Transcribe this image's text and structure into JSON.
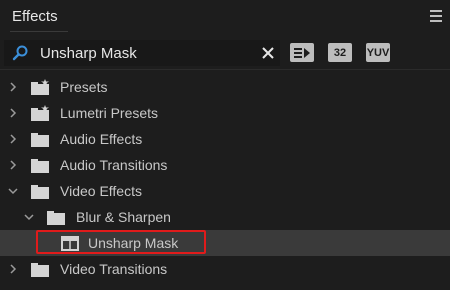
{
  "panel": {
    "title": "Effects"
  },
  "search": {
    "value": "Unsharp Mask"
  },
  "filters": {
    "accel_icon": "accelerated-effects-icon",
    "bit32_label": "32",
    "yuv_label": "YUV"
  },
  "tree": {
    "items": [
      {
        "label": "Presets",
        "icon": "folder-star-icon",
        "state": "collapsed",
        "level": 0
      },
      {
        "label": "Lumetri Presets",
        "icon": "folder-star-icon",
        "state": "collapsed",
        "level": 0
      },
      {
        "label": "Audio Effects",
        "icon": "folder-icon",
        "state": "collapsed",
        "level": 0
      },
      {
        "label": "Audio Transitions",
        "icon": "folder-icon",
        "state": "collapsed",
        "level": 0
      },
      {
        "label": "Video Effects",
        "icon": "folder-icon",
        "state": "expanded",
        "level": 0
      },
      {
        "label": "Blur & Sharpen",
        "icon": "folder-icon",
        "state": "expanded",
        "level": 1
      },
      {
        "label": "Unsharp Mask",
        "icon": "effect-icon",
        "state": "leaf",
        "level": 2,
        "selected": true
      },
      {
        "label": "Video Transitions",
        "icon": "folder-icon",
        "state": "collapsed",
        "level": 0
      }
    ]
  },
  "colors": {
    "background": "#1d1d1d",
    "selected_row": "#3a3a3a",
    "highlight": "#e01b1b",
    "search_icon": "#3b8fd9"
  }
}
